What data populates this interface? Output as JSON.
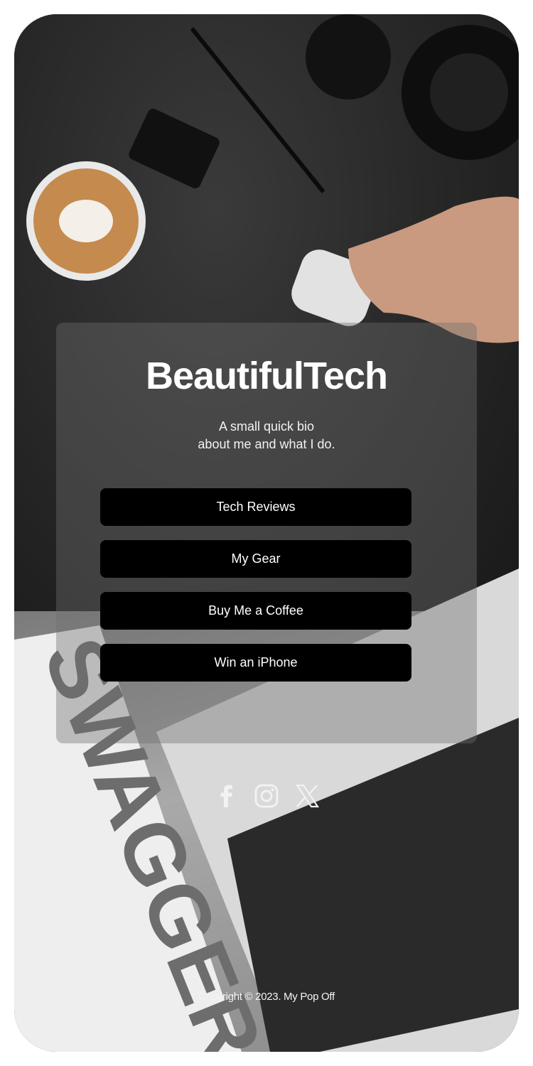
{
  "profile": {
    "name": "BeautifulTech",
    "bio_line_1": "A small quick bio",
    "bio_line_2": "about me and what I do."
  },
  "links": [
    {
      "label": "Tech Reviews"
    },
    {
      "label": "My Gear"
    },
    {
      "label": "Buy Me a Coffee"
    },
    {
      "label": "Win an iPhone"
    }
  ],
  "socials": [
    {
      "icon": "facebook-icon"
    },
    {
      "icon": "instagram-icon"
    },
    {
      "icon": "x-twitter-icon"
    }
  ],
  "footer": {
    "copyright": "Copyright © 2023. My Pop Off"
  },
  "colors": {
    "button_bg": "#000000",
    "text": "#ffffff",
    "card_overlay": "rgba(110,110,110,0.40)"
  }
}
